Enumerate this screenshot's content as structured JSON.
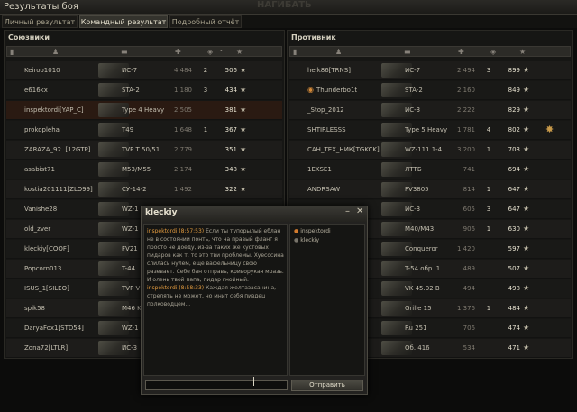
{
  "window": {
    "title": "Результаты боя",
    "background_text": "НАГИБАТЬ"
  },
  "tabs": [
    {
      "label": "Личный результат",
      "active": false
    },
    {
      "label": "Командный результат",
      "active": true
    },
    {
      "label": "Подробный отчёт",
      "active": false
    }
  ],
  "allies": {
    "title": "Союзники",
    "rows": [
      {
        "player": "Keiroo1010",
        "tank": "ИС-7",
        "damage": "4 484",
        "kills": "2",
        "xp": "506"
      },
      {
        "player": "e616kx",
        "tank": "STA-2",
        "damage": "1 180",
        "kills": "3",
        "xp": "434"
      },
      {
        "player": "inspektordi[YAP_C]",
        "tank": "Type 4 Heavy",
        "damage": "2 505",
        "kills": "",
        "xp": "381"
      },
      {
        "player": "prokopleha",
        "tank": "T49",
        "damage": "1 648",
        "kills": "1",
        "xp": "367"
      },
      {
        "player": "ZARAZA_92..[12GTP]",
        "tank": "TVP T 50/51",
        "damage": "2 779",
        "kills": "",
        "xp": "351"
      },
      {
        "player": "asabist71",
        "tank": "M53/M55",
        "damage": "2 174",
        "kills": "",
        "xp": "348"
      },
      {
        "player": "kostia201111[ZLO99]",
        "tank": "СУ-14-2",
        "damage": "1 492",
        "kills": "",
        "xp": "322"
      },
      {
        "player": "Vanishe28",
        "tank": "WZ-1",
        "damage": "",
        "kills": "",
        "xp": ""
      },
      {
        "player": "old_zver",
        "tank": "WZ-1",
        "damage": "",
        "kills": "",
        "xp": ""
      },
      {
        "player": "kleckiy[COOF]",
        "tank": "FV21",
        "damage": "",
        "kills": "",
        "xp": ""
      },
      {
        "player": "Popcorn013",
        "tank": "T-44",
        "damage": "",
        "kills": "",
        "xp": ""
      },
      {
        "player": "ISUS_1[SILEO]",
        "tank": "TVP V",
        "damage": "",
        "kills": "",
        "xp": ""
      },
      {
        "player": "spik58",
        "tank": "M46 K",
        "damage": "",
        "kills": "",
        "xp": ""
      },
      {
        "player": "DaryaFox1[STD54]",
        "tank": "WZ-1",
        "damage": "",
        "kills": "",
        "xp": ""
      },
      {
        "player": "Zona72[LTLR]",
        "tank": "ИС-3",
        "damage": "",
        "kills": "",
        "xp": ""
      }
    ]
  },
  "enemies": {
    "title": "Противник",
    "rows": [
      {
        "player": "helk86[TRNS]",
        "tank": "ИС-7",
        "damage": "2 494",
        "kills": "3",
        "xp": "899"
      },
      {
        "player": "Thunderbo1t",
        "tank": "STA-2",
        "damage": "2 160",
        "kills": "",
        "xp": "849"
      },
      {
        "player": "_Stop_2012",
        "tank": "ИС-3",
        "damage": "2 222",
        "kills": "",
        "xp": "829"
      },
      {
        "player": "SHTIRLESSS",
        "tank": "Type 5 Heavy",
        "damage": "1 781",
        "kills": "4",
        "xp": "802"
      },
      {
        "player": "САН_ТЕХ_НИК[TGKCK]",
        "tank": "WZ-111 1-4",
        "damage": "3 200",
        "kills": "1",
        "xp": "703"
      },
      {
        "player": "1EKSE1",
        "tank": "ЛТТБ",
        "damage": "741",
        "kills": "",
        "xp": "694"
      },
      {
        "player": "ANDRSAW",
        "tank": "FV3805",
        "damage": "814",
        "kills": "1",
        "xp": "647"
      },
      {
        "player": "",
        "tank": "ИС-3",
        "damage": "605",
        "kills": "3",
        "xp": "647"
      },
      {
        "player": "",
        "tank": "M40/M43",
        "damage": "906",
        "kills": "1",
        "xp": "630"
      },
      {
        "player": "",
        "tank": "Conqueror",
        "damage": "1 420",
        "kills": "",
        "xp": "597"
      },
      {
        "player": "",
        "tank": "T-54 обр. 1",
        "damage": "489",
        "kills": "",
        "xp": "507"
      },
      {
        "player": "",
        "tank": "VK 45.02 B",
        "damage": "494",
        "kills": "",
        "xp": "498"
      },
      {
        "player": "",
        "tank": "Grille 15",
        "damage": "1 376",
        "kills": "1",
        "xp": "484"
      },
      {
        "player": "",
        "tank": "Ru 251",
        "damage": "706",
        "kills": "",
        "xp": "474"
      },
      {
        "player": "",
        "tank": "Об. 416",
        "damage": "534",
        "kills": "",
        "xp": "471"
      }
    ]
  },
  "chat": {
    "title": "kleckiy",
    "messages": [
      {
        "author": "inspektordi (8:57:53)",
        "text": "Если ты тупорылый еблан не в состоянии понть, что на правый фланг я просто не доеду, из-за таких же кустовых пидаров как т, то это тви проблемы. Хуесосина слилась нулем, еще вафельницу свою разевает. Себе бан отправь, криворукая мразь. И олень твой папа, пидар гнойный."
      },
      {
        "author": "inspektordi (8:58:33)",
        "text": "Каждая желтазасанина, стрелять не может, но мнит себя пиздец полководцем..."
      }
    ],
    "users": [
      {
        "name": "inspektordi",
        "online": true
      },
      {
        "name": "kleckiy",
        "online": false
      }
    ],
    "input_value": "",
    "send_label": "Отправить"
  }
}
